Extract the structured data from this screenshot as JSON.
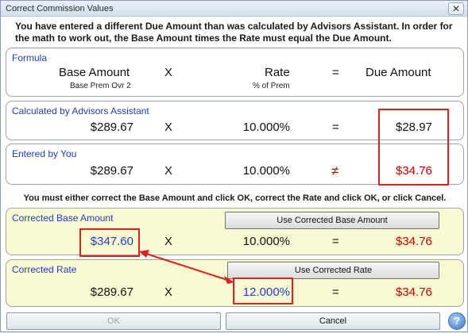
{
  "window": {
    "title": "Correct Commission Values",
    "close_glyph": "✕"
  },
  "intro_text": "You have entered a different Due Amount than was calculated by Advisors Assistant.  In order for the math to work out, the Base Amount times the Rate must equal the Due Amount.",
  "formula": {
    "label": "Formula",
    "base_header": "Base Amount",
    "base_sub": "Base Prem Ovr 2",
    "times": "X",
    "rate_header": "Rate",
    "rate_sub": "% of Prem",
    "equals": "=",
    "due_header": "Due Amount"
  },
  "calculated": {
    "label": "Calculated by Advisors Assistant",
    "base": "$289.67",
    "times": "X",
    "rate": "10.000%",
    "equals": "=",
    "due": "$28.97"
  },
  "entered": {
    "label": "Entered by You",
    "base": "$289.67",
    "times": "X",
    "rate": "10.000%",
    "not_equals": "≠",
    "due": "$34.76"
  },
  "instruction_text": "You must either correct the Base Amount and click OK, correct the Rate and click OK, or click Cancel.",
  "corrected_base": {
    "label": "Corrected Base Amount",
    "button": "Use Corrected Base Amount",
    "base": "$347.60",
    "times": "X",
    "rate": "10.000%",
    "equals": "=",
    "due": "$34.76"
  },
  "corrected_rate": {
    "label": "Corrected Rate",
    "button": "Use Corrected Rate",
    "base": "$289.67",
    "times": "X",
    "rate": "12.000%",
    "equals": "=",
    "due": "$34.76"
  },
  "buttons": {
    "ok": "OK",
    "cancel": "Cancel",
    "help": "?"
  },
  "colors": {
    "accent_blue": "#1f3fbf",
    "mismatch_red": "#cc0000",
    "highlight_panel": "#fafad2"
  }
}
